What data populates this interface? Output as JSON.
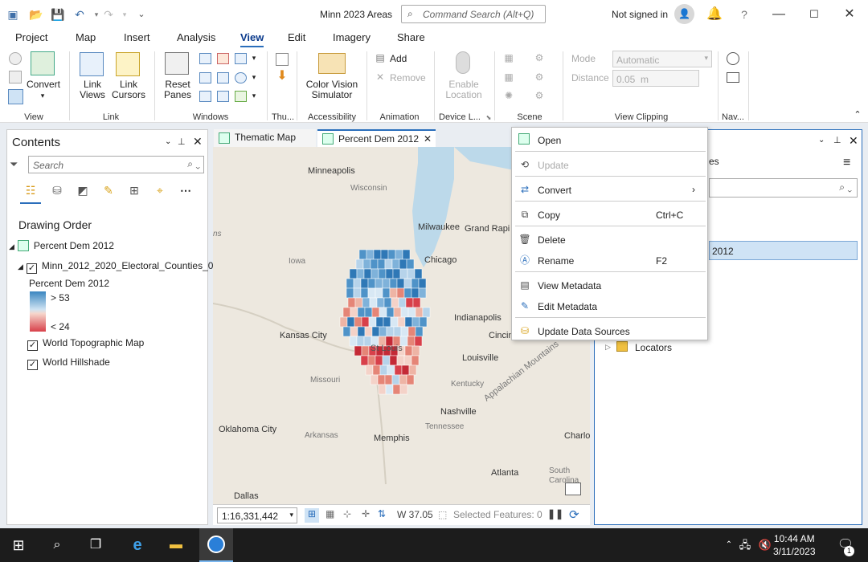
{
  "window": {
    "title": "Minn 2023 Areas",
    "command_search_placeholder": "Command Search (Alt+Q)",
    "signin": "Not signed in"
  },
  "tabs": [
    "Project",
    "Map",
    "Insert",
    "Analysis",
    "View",
    "Edit",
    "Imagery",
    "Share"
  ],
  "active_tab": "View",
  "ribbon": {
    "convert": "Convert",
    "link_views": "Link\nViews",
    "link_cursors": "Link\nCursors",
    "reset_panes": "Reset\nPanes",
    "color_vision": "Color Vision\nSimulator",
    "add": "Add",
    "remove": "Remove",
    "enable_location": "Enable\nLocation",
    "mode_label": "Mode",
    "mode_value": "Automatic",
    "distance_label": "Distance",
    "distance_value": "0.05  m",
    "groups": {
      "view": "View",
      "link": "Link",
      "windows": "Windows",
      "thumb": "Thu...",
      "accessibility": "Accessibility",
      "animation": "Animation",
      "device": "Device L...",
      "scene": "Scene",
      "clipping": "View Clipping",
      "nav": "Nav..."
    }
  },
  "contents": {
    "title": "Contents",
    "search_placeholder": "Search",
    "drawing_order": "Drawing Order",
    "map_name": "Percent Dem 2012",
    "layer": "Minn_2012_2020_Electoral_Counties_0",
    "legend_title": "Percent Dem 2012",
    "legend_high": "> 53",
    "legend_low": "< 24",
    "basemap1": "World Topographic Map",
    "basemap2": "World Hillshade"
  },
  "map_tabs": [
    "Thematic Map",
    "Percent Dem 2012"
  ],
  "map": {
    "labels": [
      "Minneapolis",
      "Wisconsin",
      "Milwaukee",
      "Grand Rapi",
      "Chicago",
      "Iowa",
      "Indianapolis",
      "Kansas City",
      "Cincin",
      "St Louis",
      "Louisville",
      "Missouri",
      "Kentucky",
      "Nashville",
      "Tennessee",
      "Appalachian Mountains",
      "Oklahoma City",
      "Arkansas",
      "Memphis",
      "Charlo",
      "Atlanta",
      "South Carolina",
      "Dallas",
      "ns"
    ],
    "scale": "1:16,331,442",
    "coord": "W 37.05",
    "selected": "Selected Features: 0"
  },
  "right_panel": {
    "partial_title": "es",
    "item_partial": "2012",
    "locators": "Locators"
  },
  "context_menu": [
    {
      "label": "Open",
      "shortcut": "",
      "enabled": true,
      "icon": "map-icon"
    },
    {
      "label": "Update",
      "shortcut": "",
      "enabled": false,
      "icon": "update-icon"
    },
    {
      "label": "Convert",
      "shortcut": "",
      "enabled": true,
      "icon": "convert-icon",
      "submenu": true
    },
    {
      "label": "Copy",
      "shortcut": "Ctrl+C",
      "enabled": true,
      "icon": "copy-icon"
    },
    {
      "label": "Delete",
      "shortcut": "",
      "enabled": true,
      "icon": "delete-icon"
    },
    {
      "label": "Rename",
      "shortcut": "F2",
      "enabled": true,
      "icon": "rename-icon"
    },
    {
      "label": "View Metadata",
      "shortcut": "",
      "enabled": true,
      "icon": "metadata-icon"
    },
    {
      "label": "Edit Metadata",
      "shortcut": "",
      "enabled": true,
      "icon": "edit-metadata-icon"
    },
    {
      "label": "Update Data Sources",
      "shortcut": "",
      "enabled": true,
      "icon": "update-sources-icon"
    }
  ],
  "taskbar": {
    "time": "10:44 AM",
    "date": "3/11/2023",
    "notifications": "1"
  },
  "colors": {
    "accent": "#2a6ebb",
    "dem_blue": "#3a86c0",
    "rep_red": "#d8404a"
  }
}
